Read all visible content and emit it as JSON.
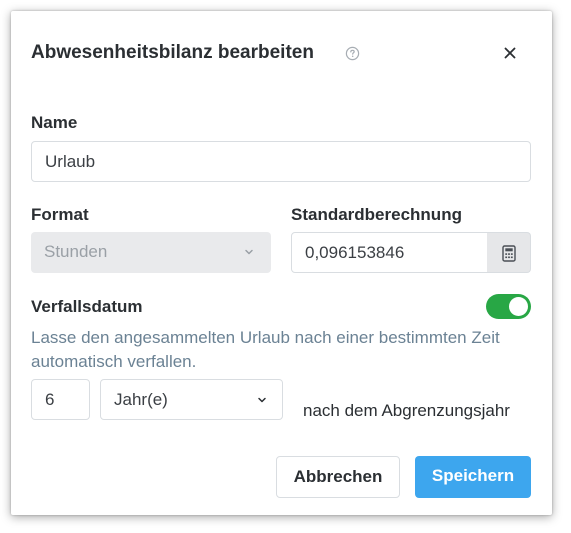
{
  "dialog": {
    "title": "Abwesenheitsbilanz bearbeiten",
    "icons": {
      "help": "help-circle-icon",
      "close": "close-icon"
    }
  },
  "name_field": {
    "label": "Name",
    "value": "Urlaub"
  },
  "format_field": {
    "label": "Format",
    "value": "Stunden",
    "disabled": true
  },
  "default_calc_field": {
    "label": "Standardberechnung",
    "value": "0,096153846",
    "button_icon": "calculator-icon"
  },
  "expiry": {
    "label": "Verfallsdatum",
    "enabled": true,
    "description": "Lasse den angesammelten Urlaub nach einer bestimmten Zeit automatisch verfallen.",
    "amount": "6",
    "unit": "Jahr(e)",
    "suffix": "nach dem Abgrenzungsjahr"
  },
  "buttons": {
    "cancel": "Abbrechen",
    "save": "Speichern"
  },
  "colors": {
    "accent": "#3da6ee",
    "toggle_on": "#28a745",
    "description": "#6b8294"
  }
}
